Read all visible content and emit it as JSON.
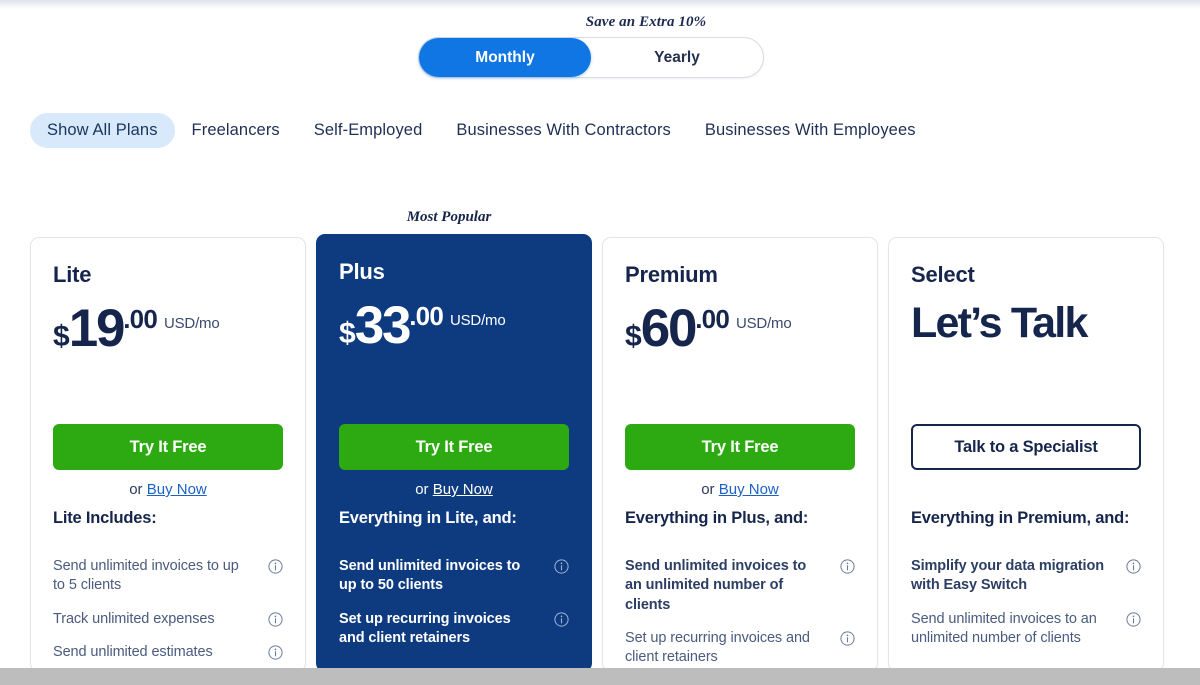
{
  "billing": {
    "save_note": "Save an Extra 10%",
    "options": [
      {
        "label": "Monthly",
        "active": true
      },
      {
        "label": "Yearly",
        "active": false
      }
    ]
  },
  "filters": [
    {
      "label": "Show All Plans",
      "active": true
    },
    {
      "label": "Freelancers",
      "active": false
    },
    {
      "label": "Self-Employed",
      "active": false
    },
    {
      "label": "Businesses With Contractors",
      "active": false
    },
    {
      "label": "Businesses With Employees",
      "active": false
    }
  ],
  "badges": {
    "most_popular": "Most Popular"
  },
  "colors": {
    "accent_blue": "#0f76e3",
    "featured_navy": "#0e3b80",
    "cta_green": "#2daa12",
    "text_navy": "#15254c",
    "pill_light_blue": "#d7e9fb",
    "link_blue": "#1b62c4"
  },
  "plans": [
    {
      "name": "Lite",
      "currency": "$",
      "amount": "19",
      "cents": ".00",
      "unit": "USD/mo",
      "cta_label": "Try It Free",
      "secondary_prefix": "or ",
      "secondary_link": "Buy Now",
      "includes_title": "Lite Includes:",
      "features": [
        {
          "text": "Send unlimited invoices to up to 5 clients",
          "bold": false,
          "info": "info-icon"
        },
        {
          "text": "Track unlimited expenses",
          "bold": false,
          "info": "info-icon"
        },
        {
          "text": "Send unlimited estimates",
          "bold": false,
          "info": "info-icon"
        }
      ]
    },
    {
      "name": "Plus",
      "featured": true,
      "currency": "$",
      "amount": "33",
      "cents": ".00",
      "unit": "USD/mo",
      "cta_label": "Try It Free",
      "secondary_prefix": "or ",
      "secondary_link": "Buy Now",
      "includes_title": "Everything in Lite, and:",
      "features": [
        {
          "text": "Send unlimited invoices to up to 50 clients",
          "bold": true,
          "info": "info-icon"
        },
        {
          "text": "Set up recurring invoices and client retainers",
          "bold": true,
          "info": "info-icon"
        }
      ]
    },
    {
      "name": "Premium",
      "currency": "$",
      "amount": "60",
      "cents": ".00",
      "unit": "USD/mo",
      "cta_label": "Try It Free",
      "secondary_prefix": "or ",
      "secondary_link": "Buy Now",
      "includes_title": "Everything in Plus, and:",
      "features": [
        {
          "text": "Send unlimited invoices to an unlimited number of clients",
          "bold": true,
          "info": "info-icon"
        },
        {
          "text": "Set up recurring invoices and client retainers",
          "bold": false,
          "info": "info-icon"
        }
      ]
    },
    {
      "name": "Select",
      "headline": "Let’s Talk",
      "cta_label": "Talk to a Specialist",
      "includes_title": "Everything in Premium, and:",
      "features": [
        {
          "text": "Simplify your data migration with Easy Switch",
          "bold": true,
          "info": "info-icon"
        },
        {
          "text": "Send unlimited invoices to an unlimited number of clients",
          "bold": false,
          "info": "info-icon"
        }
      ]
    }
  ]
}
